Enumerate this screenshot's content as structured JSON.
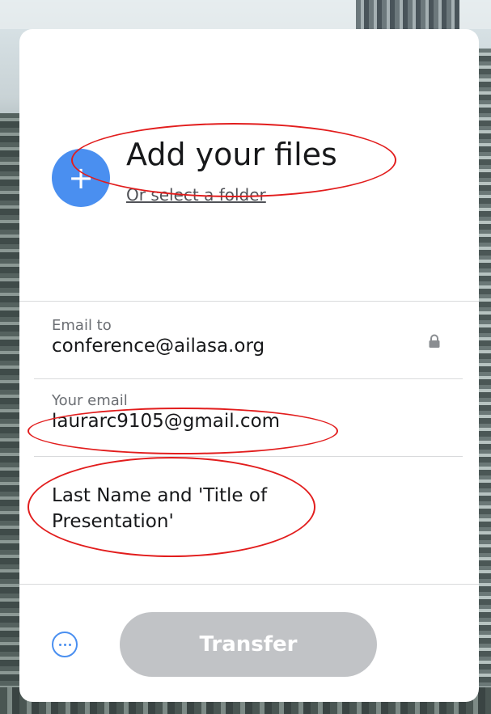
{
  "upload": {
    "title": "Add your files",
    "folder_link": "Or select a folder",
    "plus_symbol": "+"
  },
  "email_to": {
    "label": "Email to",
    "value": "conference@ailasa.org",
    "icon": "lock-icon"
  },
  "your_email": {
    "label": "Your email",
    "value": "laurarc9105@gmail.com"
  },
  "message": {
    "value": "Last Name and 'Title of Presentation'"
  },
  "actions": {
    "more_icon": "more-options-icon",
    "transfer_label": "Transfer"
  },
  "colors": {
    "accent": "#4a8ff0",
    "disabled_button": "#c1c3c6",
    "annotation": "#e21d1d"
  }
}
